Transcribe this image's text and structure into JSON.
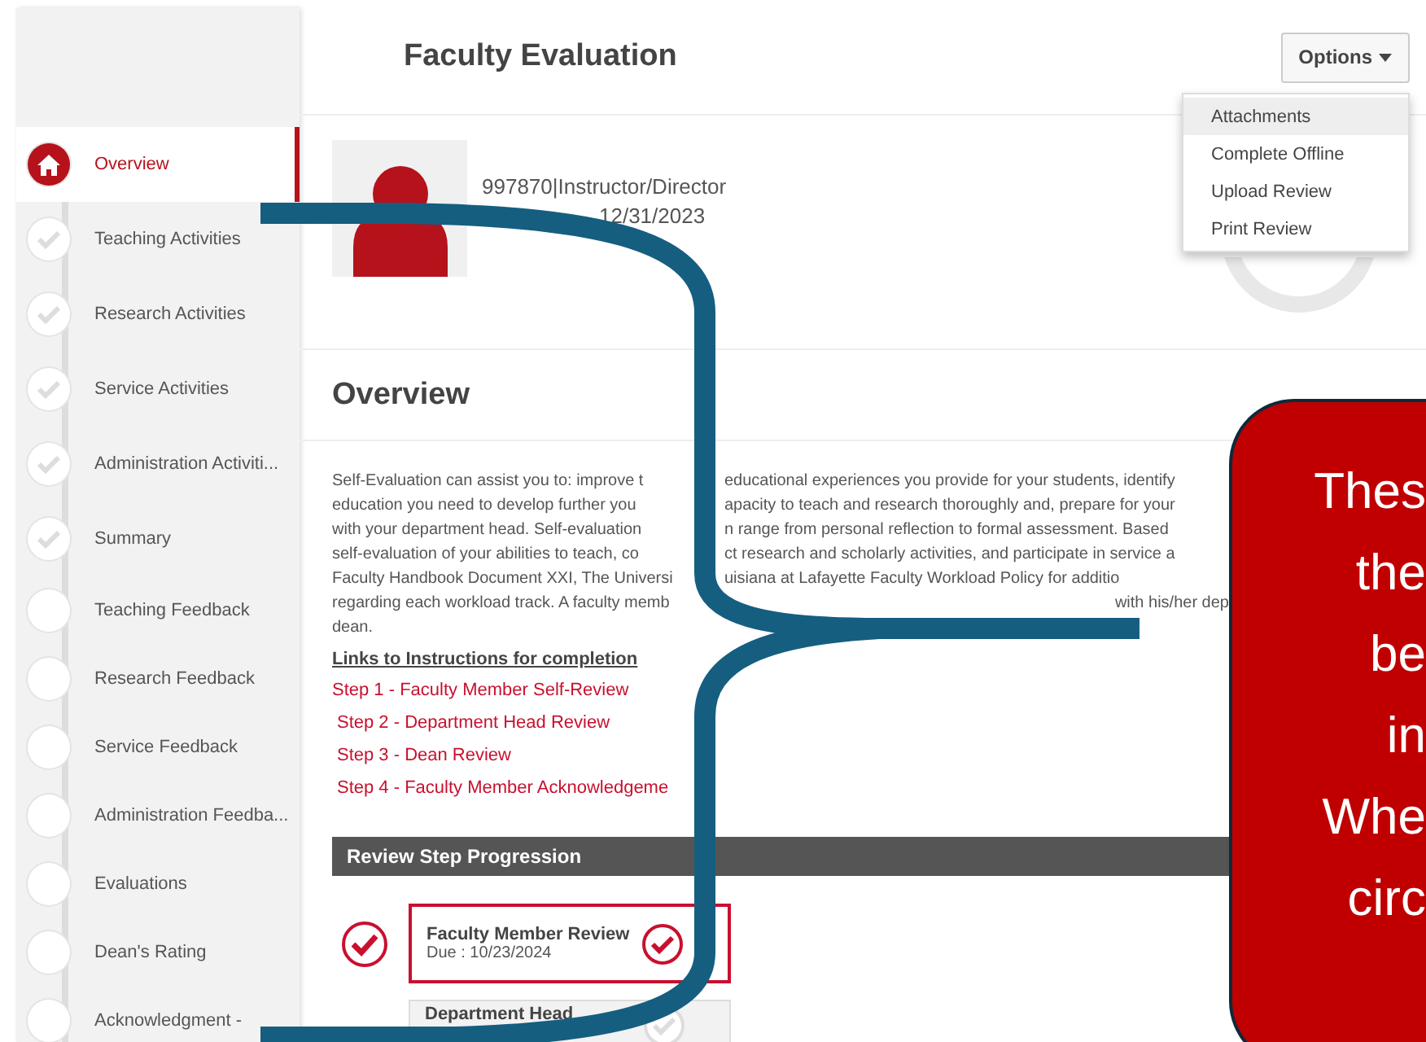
{
  "sidebar": {
    "items": [
      {
        "label": "Overview",
        "selected": true,
        "completed": false
      },
      {
        "label": "Teaching Activities",
        "selected": false,
        "completed": true
      },
      {
        "label": "Research Activities",
        "selected": false,
        "completed": true
      },
      {
        "label": "Service Activities",
        "selected": false,
        "completed": true
      },
      {
        "label": "Administration Activiti...",
        "selected": false,
        "completed": true
      },
      {
        "label": "Summary",
        "selected": false,
        "completed": true
      },
      {
        "label": "Teaching Feedback",
        "selected": false,
        "completed": false
      },
      {
        "label": "Research Feedback",
        "selected": false,
        "completed": false
      },
      {
        "label": "Service Feedback",
        "selected": false,
        "completed": false
      },
      {
        "label": "Administration Feedba...",
        "selected": false,
        "completed": false
      },
      {
        "label": "Evaluations",
        "selected": false,
        "completed": false
      },
      {
        "label": "Dean's Rating",
        "selected": false,
        "completed": false
      },
      {
        "label": "Acknowledgment -",
        "selected": false,
        "completed": false
      }
    ]
  },
  "header": {
    "title": "Faculty Evaluation",
    "options_button": "Options",
    "options_menu": [
      {
        "label": "Attachments",
        "selected": true
      },
      {
        "label": "Complete Offline",
        "selected": false
      },
      {
        "label": "Upload Review",
        "selected": false
      },
      {
        "label": "Print Review",
        "selected": false
      }
    ]
  },
  "profile": {
    "id_role": "997870|Instructor/Director",
    "period": "12/31/2023"
  },
  "overview": {
    "heading": "Overview",
    "paragraph_lines": [
      {
        "kind": "split",
        "segments": [
          "Self-Evaluation can assist you to: improve t",
          "educational experiences you provide for your students, identify"
        ]
      },
      {
        "kind": "split",
        "segments": [
          "education you need to develop further you",
          "apacity to teach and research thoroughly and, prepare for your"
        ]
      },
      {
        "kind": "split",
        "segments": [
          "with your department head. Self-evaluation",
          "n range from personal reflection to formal assessment. Based"
        ]
      },
      {
        "kind": "split",
        "segments": [
          "self-evaluation of your abilities to teach, co",
          "ct research and scholarly activities, and participate in service a"
        ]
      },
      {
        "kind": "split",
        "segments": [
          "Faculty Handbook Document XXI, The Universi",
          "uisiana at Lafayette Faculty Workload Policy for additio"
        ]
      },
      {
        "kind": "tail",
        "segments": [
          "regarding each workload track. A faculty memb",
          "with his/her dep"
        ]
      },
      {
        "kind": "whole",
        "segments": [
          "dean."
        ]
      }
    ],
    "links_heading": "Links to Instructions for completion",
    "links": [
      "Step 1 - Faculty Member Self-Review",
      "Step 2 - Department Head Review",
      "Step 3 - Dean Review",
      "Step 4 - Faculty Member Acknowledgeme"
    ]
  },
  "review_progression": {
    "title": "Review Step Progression",
    "steps": [
      {
        "name": "Faculty Member Review",
        "due": "Due :  10/23/2024",
        "current": true
      },
      {
        "name": "Department Head",
        "current": false
      }
    ]
  },
  "callout": {
    "lines": [
      "Thes",
      "the",
      "be",
      "in",
      "Whe",
      "circ"
    ]
  }
}
